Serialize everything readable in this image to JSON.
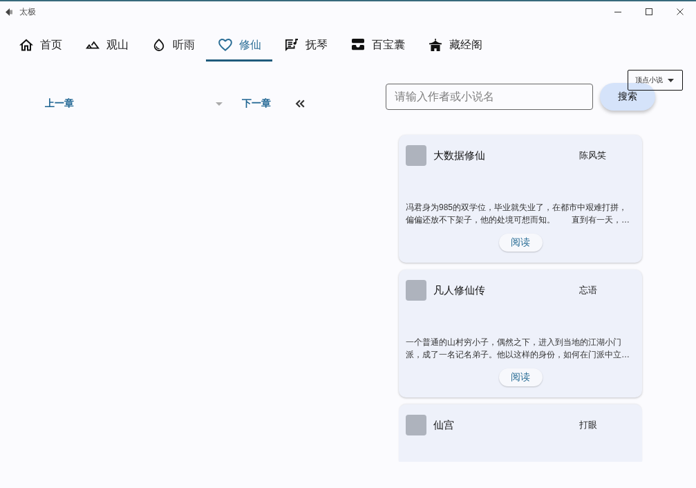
{
  "window": {
    "title": "太极"
  },
  "tabs": [
    {
      "label": "首页",
      "selected": false
    },
    {
      "label": "观山",
      "selected": false
    },
    {
      "label": "听雨",
      "selected": false
    },
    {
      "label": "修仙",
      "selected": true
    },
    {
      "label": "抚琴",
      "selected": false
    },
    {
      "label": "百宝囊",
      "selected": false
    },
    {
      "label": "藏经阁",
      "selected": false
    }
  ],
  "chapter_nav": {
    "previous": "上一章",
    "next": "下一章"
  },
  "search": {
    "placeholder": "请输入作者或小说名",
    "button": "搜索",
    "source": "顶点小说"
  },
  "books": [
    {
      "title": "大数据修仙",
      "author": "陈风笑",
      "description": "冯君身为985的双学位，毕业就失业了，在都市中艰难打拼，偏偏还放不下架子，他的处境可想而知。　　直到有一天，…",
      "action": "阅读"
    },
    {
      "title": "凡人修仙传",
      "author": "忘语",
      "description": "一个普通的山村穷小子，偶然之下，进入到当地的江湖小门派，成了一名记名弟子。他以这样的身份，如何在门派中立…",
      "action": "阅读"
    },
    {
      "title": "仙宫",
      "author": "打眼"
    }
  ]
}
